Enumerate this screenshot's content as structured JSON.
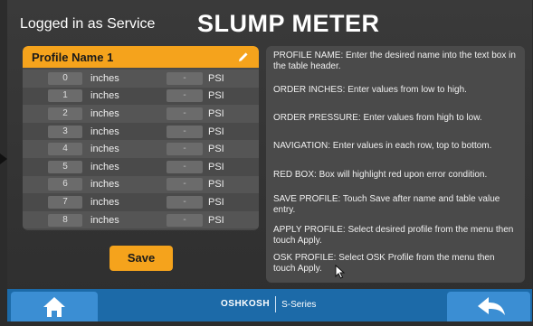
{
  "header": {
    "login_text": "Logged in as Service",
    "title": "SLUMP METER"
  },
  "profile": {
    "name": "Profile Name 1",
    "rows": [
      {
        "inches": "0",
        "inch_unit": "inches",
        "psi": "-",
        "psi_unit": "PSI"
      },
      {
        "inches": "1",
        "inch_unit": "inches",
        "psi": "-",
        "psi_unit": "PSI"
      },
      {
        "inches": "2",
        "inch_unit": "inches",
        "psi": "-",
        "psi_unit": "PSI"
      },
      {
        "inches": "3",
        "inch_unit": "inches",
        "psi": "-",
        "psi_unit": "PSI"
      },
      {
        "inches": "4",
        "inch_unit": "inches",
        "psi": "-",
        "psi_unit": "PSI"
      },
      {
        "inches": "5",
        "inch_unit": "inches",
        "psi": "-",
        "psi_unit": "PSI"
      },
      {
        "inches": "6",
        "inch_unit": "inches",
        "psi": "-",
        "psi_unit": "PSI"
      },
      {
        "inches": "7",
        "inch_unit": "inches",
        "psi": "-",
        "psi_unit": "PSI"
      },
      {
        "inches": "8",
        "inch_unit": "inches",
        "psi": "-",
        "psi_unit": "PSI"
      }
    ],
    "save_label": "Save"
  },
  "help": {
    "profile_name": "PROFILE NAME: Enter the desired name into the text box in the table header.",
    "order_inches": "ORDER INCHES: Enter values from low to high.",
    "order_pressure": "ORDER PRESSURE: Enter values from high to low.",
    "navigation": "NAVIGATION: Enter values in each row, top to bottom.",
    "red_box": "RED BOX: Box will highlight red upon error condition.",
    "save_profile": "SAVE PROFILE: Touch Save after name and table value entry.",
    "apply_profile": "APPLY PROFILE: Select desired profile from the menu then touch Apply.",
    "osk_profile": "OSK PROFILE: Select OSK Profile from the menu then touch Apply."
  },
  "footer": {
    "brand_logo": "OSHKOSH",
    "brand_series": "S-Series",
    "home_icon": "home-icon",
    "back_icon": "back-arrow-icon"
  },
  "colors": {
    "accent": "#f5a31c",
    "footer_blue": "#1c6aa8",
    "button_blue": "#3b8ed3"
  }
}
